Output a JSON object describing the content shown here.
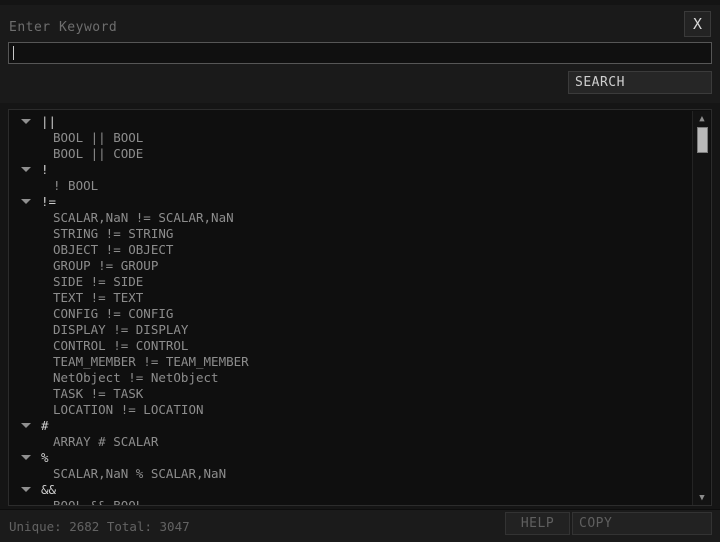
{
  "window": {
    "title_label": "Enter Keyword",
    "close_label": "X"
  },
  "search": {
    "input_value": "",
    "placeholder": "",
    "button_label": "SEARCH"
  },
  "tree": {
    "groups": [
      {
        "label": "||",
        "expanded": true,
        "children": [
          "BOOL || BOOL",
          "BOOL || CODE"
        ]
      },
      {
        "label": "!",
        "expanded": true,
        "children": [
          "! BOOL"
        ]
      },
      {
        "label": "!=",
        "expanded": true,
        "children": [
          "SCALAR,NaN != SCALAR,NaN",
          "STRING != STRING",
          "OBJECT != OBJECT",
          "GROUP != GROUP",
          "SIDE != SIDE",
          "TEXT != TEXT",
          "CONFIG != CONFIG",
          "DISPLAY != DISPLAY",
          "CONTROL != CONTROL",
          "TEAM_MEMBER != TEAM_MEMBER",
          "NetObject != NetObject",
          "TASK != TASK",
          "LOCATION != LOCATION"
        ]
      },
      {
        "label": "#",
        "expanded": true,
        "children": [
          "ARRAY # SCALAR"
        ]
      },
      {
        "label": "%",
        "expanded": true,
        "children": [
          "SCALAR,NaN % SCALAR,NaN"
        ]
      },
      {
        "label": "&&",
        "expanded": true,
        "children": [
          "BOOL && BOOL"
        ]
      }
    ]
  },
  "scrollbar": {
    "up_arrow": "▲",
    "down_arrow": "▼"
  },
  "status": {
    "text": "Unique: 2682  Total: 3047"
  },
  "footer": {
    "help_label": "HELP",
    "copy_label": "COPY"
  },
  "colors": {
    "window_bg": "#151515",
    "header_bg": "#1a1a1a",
    "list_bg": "#0f0f0f",
    "group_text": "#cdcdcd",
    "child_text": "#8d8d8d",
    "dim_text": "#636363",
    "thumb": "#b9b9b9"
  }
}
